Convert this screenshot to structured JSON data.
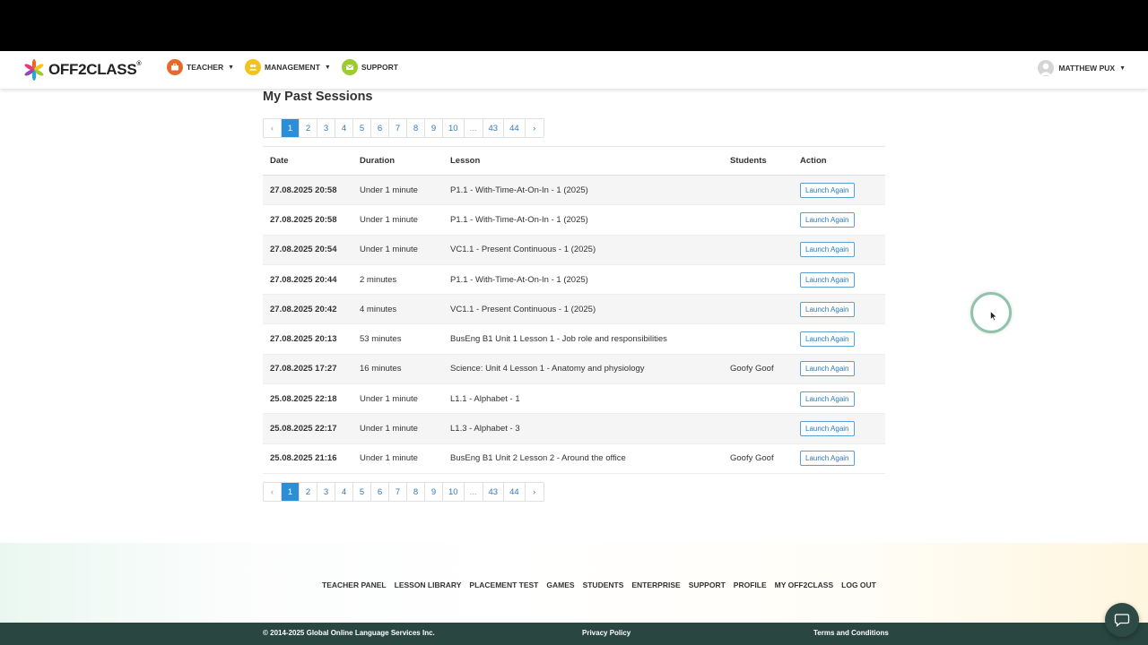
{
  "brand": {
    "logo_text": "OFF2CLASS",
    "logo_mark": "®"
  },
  "nav": {
    "items": [
      {
        "label": "TEACHER",
        "icon": "briefcase-icon",
        "color": "#e8672a",
        "dropdown": true
      },
      {
        "label": "MANAGEMENT",
        "icon": "users-icon",
        "color": "#f2c41b",
        "dropdown": true
      },
      {
        "label": "SUPPORT",
        "icon": "mail-icon",
        "color": "#9ccd2e",
        "dropdown": false
      }
    ],
    "user_name": "MATTHEW PUX"
  },
  "page": {
    "title": "My Past Sessions"
  },
  "pagination": {
    "prev": "‹",
    "next": "›",
    "pages": [
      "1",
      "2",
      "3",
      "4",
      "5",
      "6",
      "7",
      "8",
      "9",
      "10",
      "...",
      "43",
      "44"
    ],
    "current": "1"
  },
  "table": {
    "headers": {
      "date": "Date",
      "duration": "Duration",
      "lesson": "Lesson",
      "students": "Students",
      "action": "Action"
    },
    "button_label": "Launch Again",
    "rows": [
      {
        "date": "27.08.2025 20:58",
        "duration": "Under 1 minute",
        "lesson": "P1.1 - With-Time-At-On-In - 1 (2025)",
        "students": ""
      },
      {
        "date": "27.08.2025 20:58",
        "duration": "Under 1 minute",
        "lesson": "P1.1 - With-Time-At-On-In - 1 (2025)",
        "students": ""
      },
      {
        "date": "27.08.2025 20:54",
        "duration": "Under 1 minute",
        "lesson": "VC1.1 - Present Continuous - 1 (2025)",
        "students": ""
      },
      {
        "date": "27.08.2025 20:44",
        "duration": "2 minutes",
        "lesson": "P1.1 - With-Time-At-On-In - 1 (2025)",
        "students": ""
      },
      {
        "date": "27.08.2025 20:42",
        "duration": "4 minutes",
        "lesson": "VC1.1 - Present Continuous - 1 (2025)",
        "students": ""
      },
      {
        "date": "27.08.2025 20:13",
        "duration": "53 minutes",
        "lesson": "BusEng B1 Unit 1 Lesson 1 - Job role and responsibilities",
        "students": ""
      },
      {
        "date": "27.08.2025 17:27",
        "duration": "16 minutes",
        "lesson": "Science: Unit 4 Lesson 1 - Anatomy and physiology",
        "students": "Goofy Goof"
      },
      {
        "date": "25.08.2025 22:18",
        "duration": "Under 1 minute",
        "lesson": "L1.1 - Alphabet - 1",
        "students": ""
      },
      {
        "date": "25.08.2025 22:17",
        "duration": "Under 1 minute",
        "lesson": "L1.3 - Alphabet - 3",
        "students": ""
      },
      {
        "date": "25.08.2025 21:16",
        "duration": "Under 1 minute",
        "lesson": "BusEng B1 Unit 2 Lesson 2 - Around the office",
        "students": "Goofy Goof"
      }
    ]
  },
  "footer": {
    "links": [
      "TEACHER PANEL",
      "LESSON LIBRARY",
      "PLACEMENT TEST",
      "GAMES",
      "STUDENTS",
      "ENTERPRISE",
      "SUPPORT",
      "PROFILE",
      "MY OFF2CLASS",
      "LOG OUT"
    ],
    "copyright": "© 2014-2025 Global Online Language Services Inc.",
    "privacy": "Privacy Policy",
    "terms": "Terms and Conditions"
  },
  "colors": {
    "accent": "#2a8fd6",
    "footer_bar": "#294640",
    "chat": "#2d4a45"
  }
}
